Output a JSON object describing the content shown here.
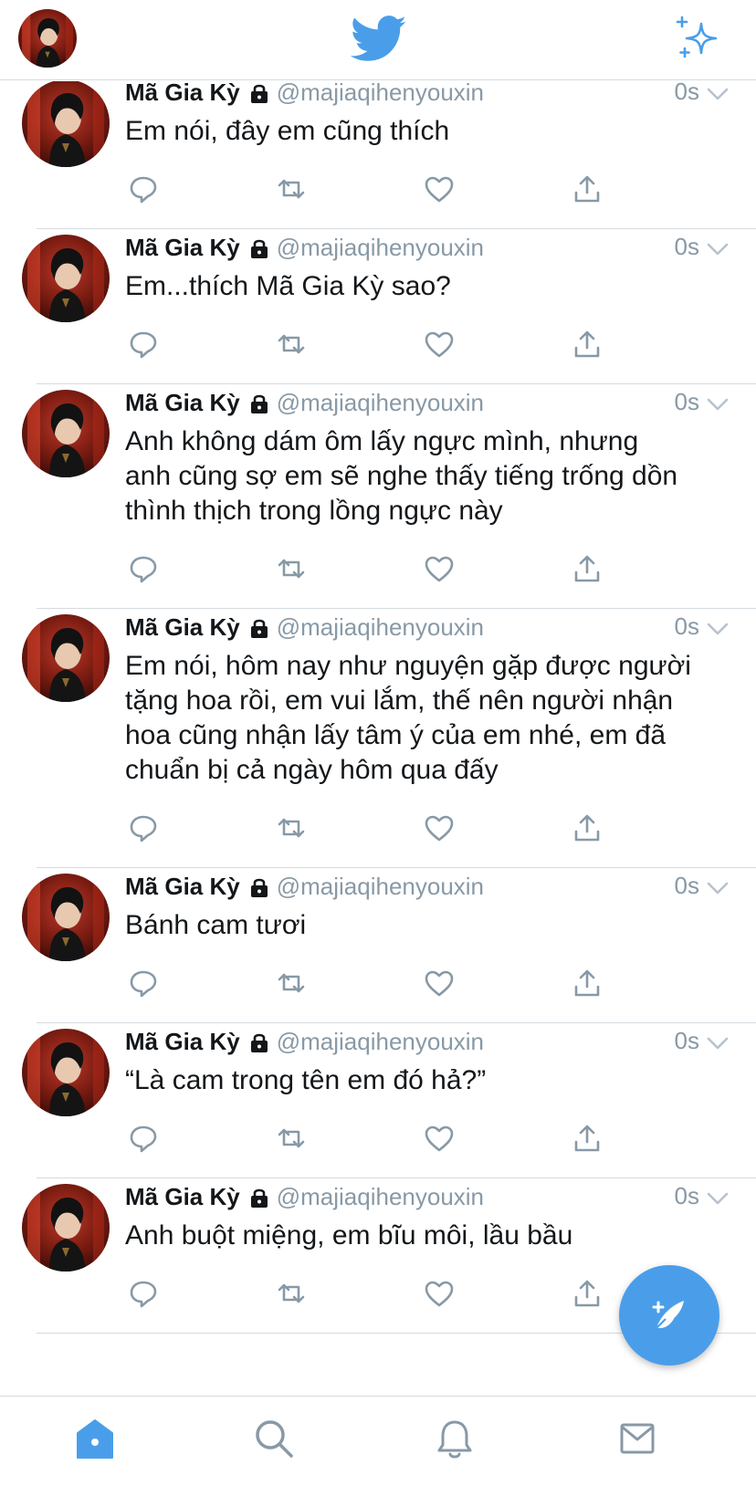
{
  "colors": {
    "brand": "#4a9ee9",
    "text": "#14171a",
    "secondary": "#8899a6",
    "divider": "#d5dbe0"
  },
  "header": {
    "profile_icon": "profile-avatar",
    "logo_icon": "twitter-bird-icon",
    "top_tweets_icon": "sparkle-icon"
  },
  "tweets": [
    {
      "name": "Mã Gia Kỳ",
      "handle": "@majiaqihenyouxin",
      "time": "0s",
      "lines": [
        "Em nói, đây em cũng thích"
      ]
    },
    {
      "name": "Mã Gia Kỳ",
      "handle": "@majiaqihenyouxin",
      "time": "0s",
      "lines": [
        "Em...thích Mã Gia Kỳ sao?"
      ]
    },
    {
      "name": "Mã Gia Kỳ",
      "handle": "@majiaqihenyouxin",
      "time": "0s",
      "lines": [
        "Anh không dám ôm lấy ngực mình, nhưng",
        "anh cũng sợ em sẽ nghe thấy tiếng trống dồn",
        "thình thịch trong lồng ngực này"
      ]
    },
    {
      "name": "Mã Gia Kỳ",
      "handle": "@majiaqihenyouxin",
      "time": "0s",
      "lines": [
        "Em nói, hôm nay như nguyện gặp được người",
        "tặng hoa rồi, em vui lắm, thế nên người nhận",
        "hoa cũng nhận lấy tâm ý của em nhé, em đã",
        "chuẩn bị cả ngày hôm qua đấy"
      ]
    },
    {
      "name": "Mã Gia Kỳ",
      "handle": "@majiaqihenyouxin",
      "time": "0s",
      "lines": [
        "Bánh cam tươi"
      ]
    },
    {
      "name": "Mã Gia Kỳ",
      "handle": "@majiaqihenyouxin",
      "time": "0s",
      "lines": [
        "“Là cam trong tên em đó hả?”"
      ]
    },
    {
      "name": "Mã Gia Kỳ",
      "handle": "@majiaqihenyouxin",
      "time": "0s",
      "lines": [
        "Anh buột miệng, em bĩu môi, lầu bầu"
      ]
    }
  ],
  "actions": [
    "reply-icon",
    "retweet-icon",
    "like-icon",
    "share-icon"
  ],
  "fab": {
    "icon": "compose-tweet-icon"
  },
  "bottom_nav": [
    "home-icon",
    "search-icon",
    "notifications-icon",
    "messages-icon"
  ]
}
